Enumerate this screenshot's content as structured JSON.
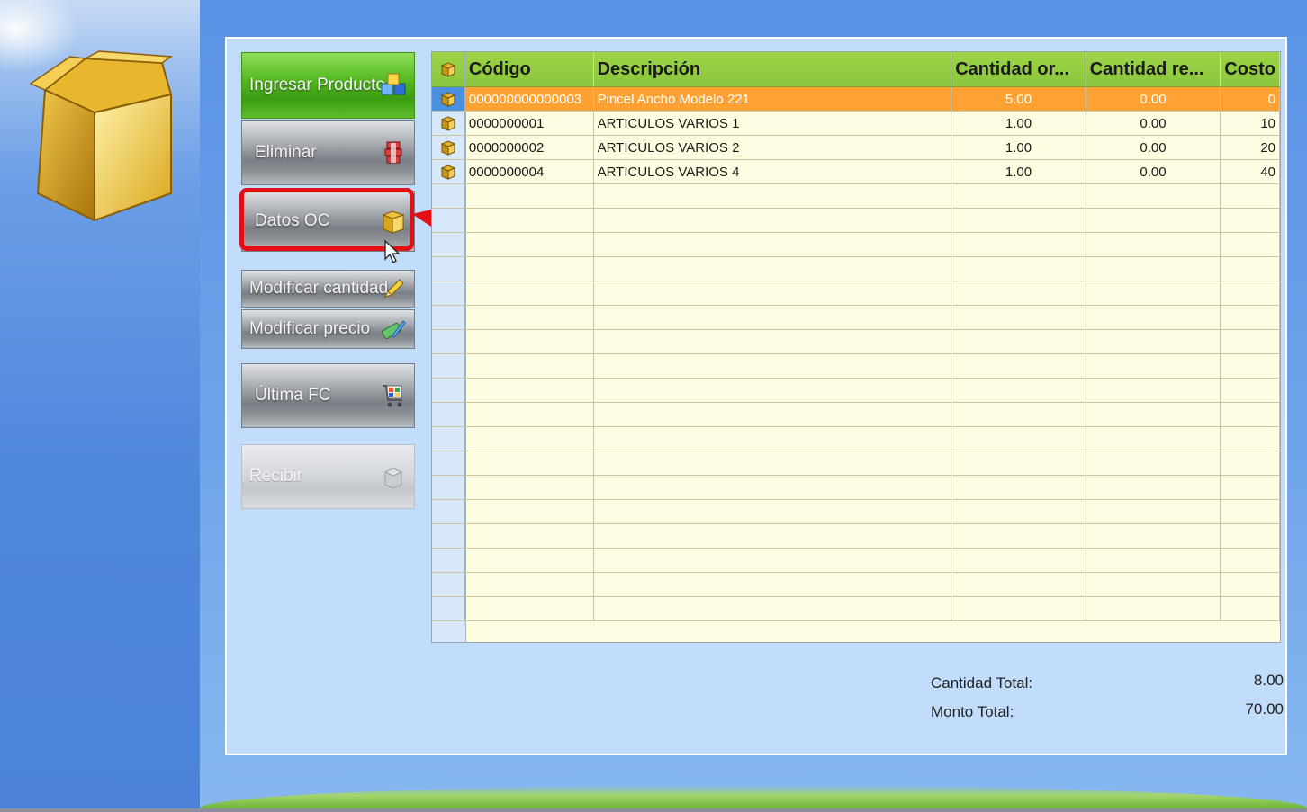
{
  "buttons": {
    "ingresar": "Ingresar Producto",
    "eliminar": "Eliminar",
    "datos_oc": "Datos OC",
    "modificar_cantidad": "Modificar cantidad",
    "modificar_precio": "Modificar precio",
    "ultima_fc": "Última FC",
    "recibir": "Recibir"
  },
  "grid": {
    "columns": [
      "Código",
      "Descripción",
      "Cantidad or...",
      "Cantidad re...",
      "Costo"
    ],
    "rows": [
      {
        "codigo": "000000000000003",
        "descripcion": "Pincel Ancho Modelo 221",
        "cant_or": "5.00",
        "cant_re": "0.00",
        "costo": "0",
        "selected": true
      },
      {
        "codigo": "0000000001",
        "descripcion": "ARTICULOS VARIOS 1",
        "cant_or": "1.00",
        "cant_re": "0.00",
        "costo": "10"
      },
      {
        "codigo": "0000000002",
        "descripcion": "ARTICULOS VARIOS 2",
        "cant_or": "1.00",
        "cant_re": "0.00",
        "costo": "20"
      },
      {
        "codigo": "0000000004",
        "descripcion": "ARTICULOS VARIOS 4",
        "cant_or": "1.00",
        "cant_re": "0.00",
        "costo": "40"
      }
    ]
  },
  "totals": {
    "cantidad_label": "Cantidad Total:",
    "cantidad_value": "8.00",
    "monto_label": "Monto Total:",
    "monto_value": "70.00"
  },
  "colors": {
    "accent_green": "#8cc63e",
    "selected_row": "#ffa233",
    "highlight_red": "#e40f14"
  }
}
